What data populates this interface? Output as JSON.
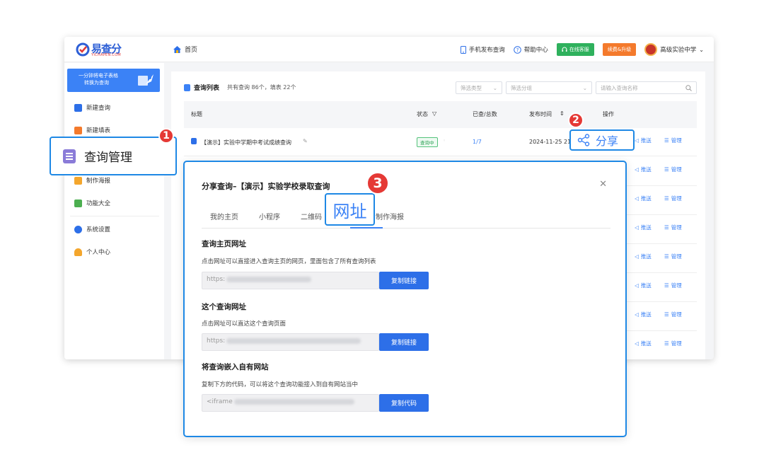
{
  "app": {
    "logo_text": "易查分",
    "logo_subtext": "YICHAPEN.COM",
    "breadcrumb_home": "首页"
  },
  "topbar": {
    "mobile_publish": "手机发布查询",
    "help_center": "帮助中心",
    "online_service": "在线客服",
    "renew_upgrade": "续费&升级",
    "user_name": "高级实验中学"
  },
  "sidebar": {
    "promo_line1": "一分钟将电子表格",
    "promo_line2": "转换为查询",
    "items": [
      {
        "label": "新建查询"
      },
      {
        "label": "新建填表"
      },
      {
        "label": "查询管理"
      },
      {
        "label": "制作海报"
      },
      {
        "label": "功能大全"
      },
      {
        "label": "系统设置"
      },
      {
        "label": "个人中心"
      }
    ]
  },
  "list": {
    "title": "查询列表",
    "summary": "共有查询 86个，填表 22个",
    "filter_type_placeholder": "筛选类型",
    "filter_group_placeholder": "筛选分组",
    "search_placeholder": "请输入查询名称",
    "columns": {
      "title": "标题",
      "status": "状态",
      "viewed_total": "已查/总数",
      "publish_time": "发布时间",
      "actions": "操作"
    },
    "rows": [
      {
        "title": "【演示】实验中学期中考试成绩查询",
        "status": "查询中",
        "viewed_total": "1/7",
        "publish_time": "2024-11-25 21"
      }
    ],
    "action_push": "推送",
    "action_manage": "管理"
  },
  "callouts": {
    "one_label": "查询管理",
    "two_label": "分享",
    "three_label": "网址",
    "n1": "1",
    "n2": "2",
    "n3": "3"
  },
  "modal": {
    "title": "分享查询–【演示】实验学校录取查询",
    "tabs": [
      "我的主页",
      "小程序",
      "二维码",
      "网址",
      "制作海报"
    ],
    "section1_title": "查询主页网址",
    "section1_desc": "点击网址可以直接进入查询主页的网页，里面包含了所有查询列表",
    "section1_value": "https:",
    "section2_title": "这个查询网址",
    "section2_desc": "点击网址可以直达这个查询页面",
    "section2_value": "https:",
    "section3_title": "将查询嵌入自有网站",
    "section3_desc": "复制下方的代码，可以将这个查询功能接入到自有网站当中",
    "section3_value": "<iframe",
    "copy_link": "复制链接",
    "copy_code": "复制代码"
  },
  "colors": {
    "accent": "#3b82f6",
    "callout_border": "#1e88e5",
    "badge_red": "#e53935",
    "green": "#2fb15d",
    "orange": "#f47a2c"
  }
}
